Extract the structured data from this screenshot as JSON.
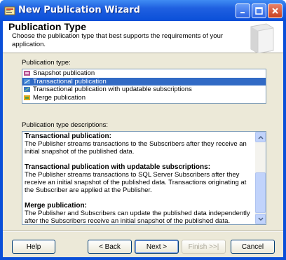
{
  "window": {
    "title": "New Publication Wizard"
  },
  "header": {
    "title": "Publication Type",
    "description": "Choose the publication type that best supports the requirements of your application."
  },
  "type_list": {
    "label": "Publication type:",
    "items": [
      {
        "label": "Snapshot publication",
        "icon": "snapshot-publication-icon"
      },
      {
        "label": "Transactional publication",
        "icon": "transactional-publication-icon",
        "selected": true
      },
      {
        "label": "Transactional publication with updatable subscriptions",
        "icon": "updatable-publication-icon"
      },
      {
        "label": "Merge publication",
        "icon": "merge-publication-icon"
      }
    ]
  },
  "descriptions": {
    "label": "Publication type descriptions:",
    "entries": [
      {
        "title": "Transactional publication:",
        "text": "The Publisher streams transactions to the Subscribers after they receive an initial snapshot of the published data."
      },
      {
        "title": "Transactional publication with updatable subscriptions:",
        "text": "The Publisher streams transactions to SQL Server Subscribers after they receive an initial snapshot of the published data. Transactions originating at the Subscriber are applied at the Publisher."
      },
      {
        "title": "Merge publication:",
        "text": "The Publisher and Subscribers can update the published data independently after the Subscribers receive an initial snapshot of the published data. Changes are"
      }
    ]
  },
  "buttons": {
    "help": "Help",
    "back": "< Back",
    "next": "Next >",
    "finish": "Finish >>|",
    "cancel": "Cancel"
  },
  "colors": {
    "selection": "#316ac5",
    "titlebar": "#0a4fd8",
    "dialog_bg": "#ece9d8"
  }
}
